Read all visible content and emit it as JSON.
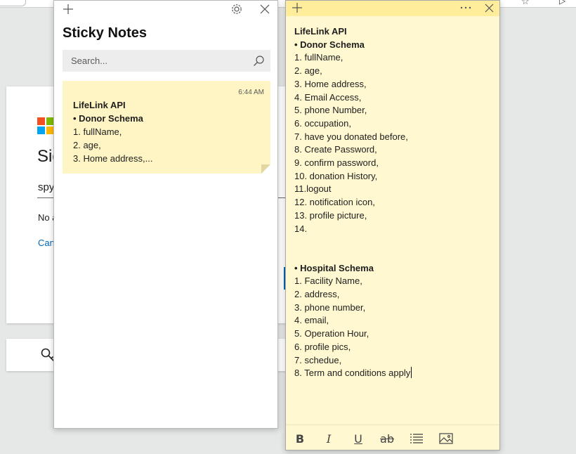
{
  "background": {
    "signin": {
      "title": "Sig",
      "email_partial": "spy",
      "no_account": "No a",
      "cant_access": "Can"
    }
  },
  "list_window": {
    "title": "Sticky Notes",
    "search_placeholder": "Search...",
    "notes": [
      {
        "time": "6:44 AM",
        "preview_title": "LifeLink API",
        "preview_heading": "• Donor Schema",
        "preview_lines": [
          "1. fullName,",
          "2. age,",
          "3. Home address,..."
        ]
      }
    ]
  },
  "note_window": {
    "content": [
      {
        "text": "LifeLink API",
        "bold": true
      },
      {
        "text": "• Donor Schema",
        "bold": true
      },
      {
        "text": "1. fullName,"
      },
      {
        "text": "2. age,"
      },
      {
        "text": "3. Home address,"
      },
      {
        "text": "4. Email Access,"
      },
      {
        "text": "5. phone Number,"
      },
      {
        "text": "6. occupation,"
      },
      {
        "text": "7. have you donated before,"
      },
      {
        "text": "8. Create Password,"
      },
      {
        "text": "9. confirm password,"
      },
      {
        "text": "10. donation History,"
      },
      {
        "text": "11.logout"
      },
      {
        "text": "12. notification icon,"
      },
      {
        "text": "13. profile picture,"
      },
      {
        "text": "14."
      },
      {
        "text": ""
      },
      {
        "text": ""
      },
      {
        "text": "• Hospital Schema",
        "bold": true
      },
      {
        "text": "1. Facility Name,"
      },
      {
        "text": "2. address,"
      },
      {
        "text": "3. phone number,"
      },
      {
        "text": "4. email,"
      },
      {
        "text": "5. Operation Hour,"
      },
      {
        "text": "6. profile pics,"
      },
      {
        "text": "7. schedue,"
      },
      {
        "text": "8. Term and conditions apply",
        "caret": true
      }
    ],
    "toolbar": {
      "bold": "B",
      "italic": "I",
      "underline": "U",
      "strikethrough": "ab"
    }
  },
  "colors": {
    "note_body": "#fff8d1",
    "note_header": "#ffed9c",
    "note_card": "#fff5c4",
    "ms_red": "#f25022",
    "ms_green": "#7fba00",
    "ms_blue": "#00a4ef",
    "ms_yellow": "#ffb900",
    "link_blue": "#0067b8"
  }
}
